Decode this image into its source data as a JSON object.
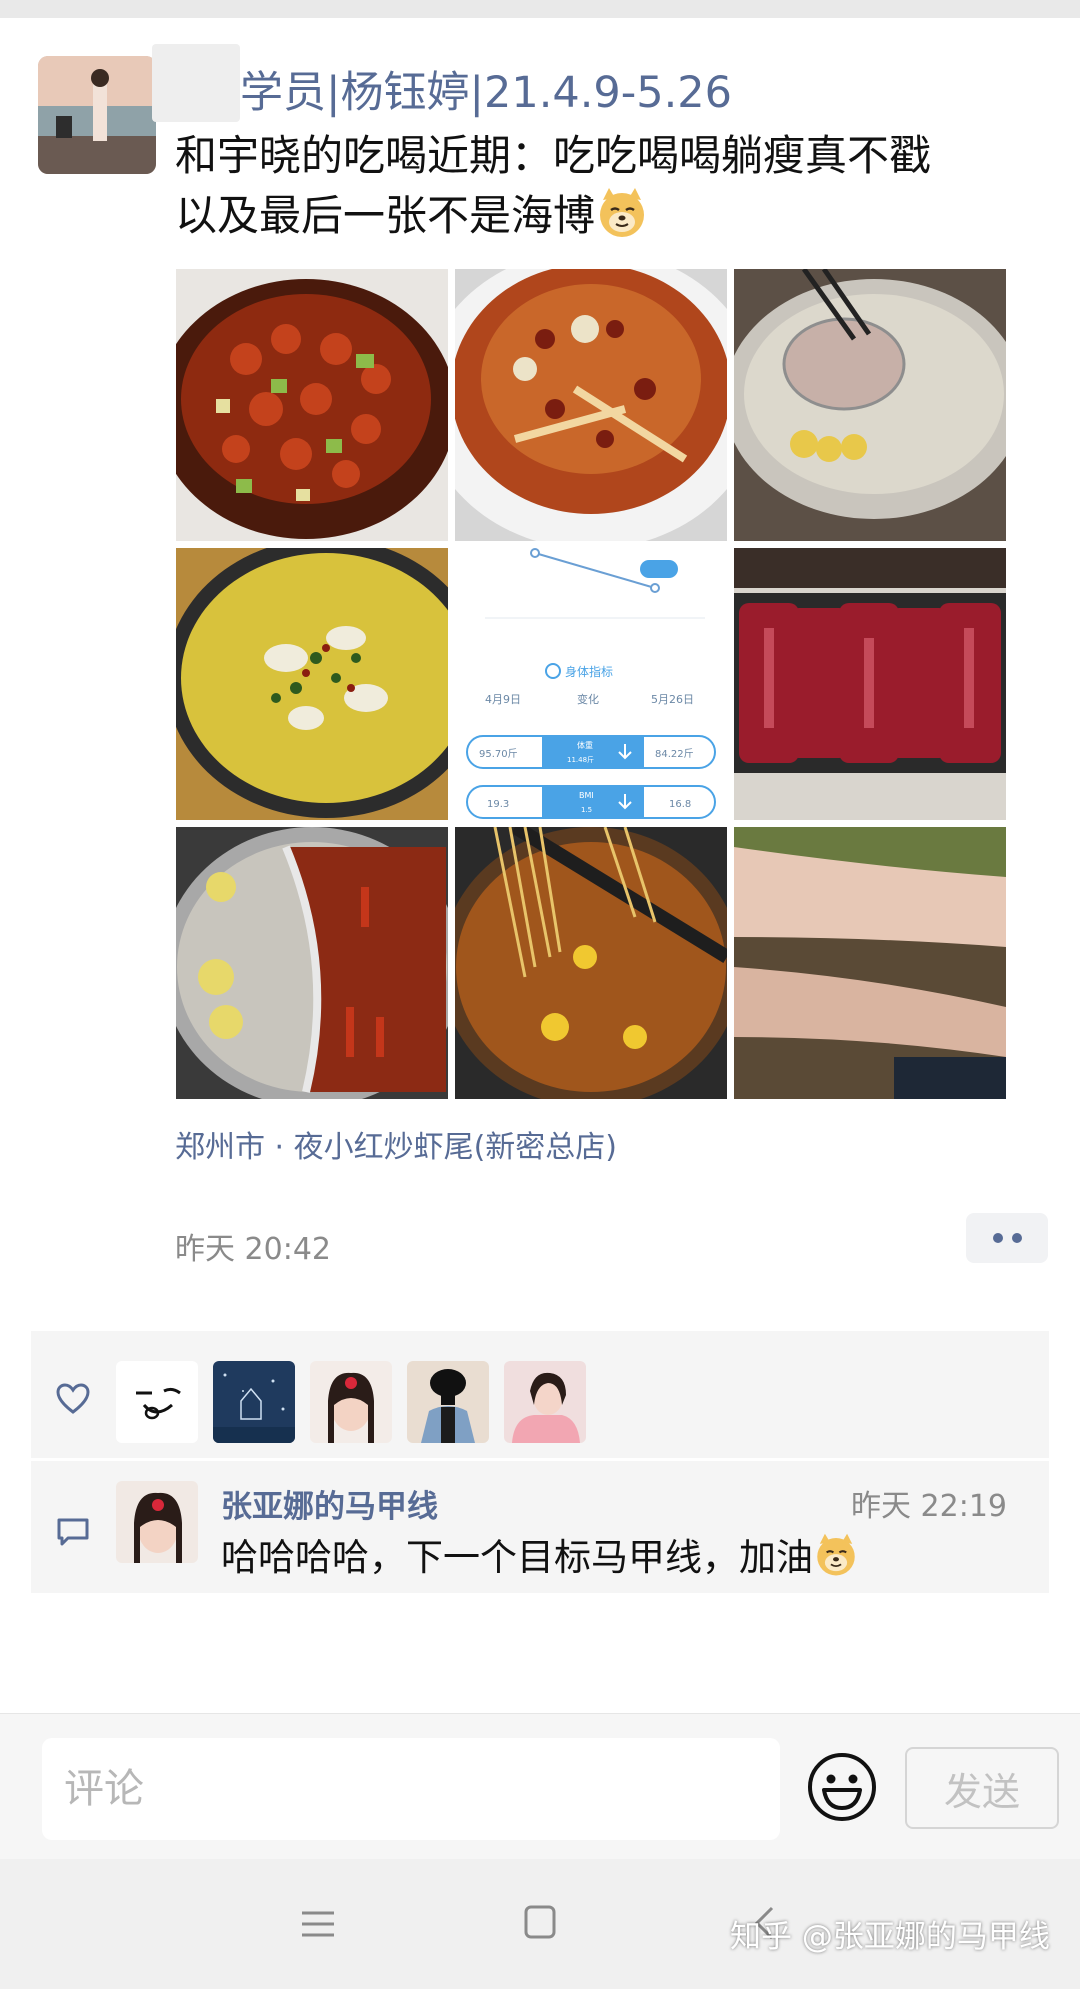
{
  "post": {
    "username": "学员|杨钰婷|21.4.9-5.26",
    "text_line1": "和宇晓的吃喝近期：吃吃喝喝躺瘦真不戳",
    "text_line2": "以及最后一张不是海博",
    "location": "郑州市 · 夜小红炒虾尾(新密总店)",
    "timestamp": "昨天 20:42",
    "images": [
      "crawfish-dish-photo",
      "spicy-fish-dish-photo",
      "clear-broth-hotpot-photo",
      "pickled-fish-dish-photo",
      "body-metrics-screenshot",
      "raw-beef-slices-photo",
      "yin-yang-hotpot-photo",
      "skewer-hotpot-photo",
      "arms-photo"
    ],
    "metrics": {
      "section_title": "身体指标",
      "col_start": "4月9日",
      "col_change": "变化",
      "col_end": "5月26日",
      "weight_start": "95.70斤",
      "weight_label": "体重",
      "weight_change": "11.48斤",
      "weight_end": "84.22斤",
      "bmi_start": "19.3",
      "bmi_label": "BMI",
      "bmi_change": "1.5",
      "bmi_end": "16.8"
    }
  },
  "likes": {
    "avatars": [
      "like-avatar-sticker",
      "like-avatar-night-sky",
      "like-avatar-girl-flower",
      "like-avatar-black-hat",
      "like-avatar-girl-pink"
    ]
  },
  "comment": {
    "author": "张亚娜的马甲线",
    "time": "昨天 22:19",
    "text": "哈哈哈哈，下一个目标马甲线，加油"
  },
  "input": {
    "placeholder": "评论",
    "send_label": "发送"
  },
  "watermark": "知乎 @张亚娜的马甲线",
  "colors": {
    "link": "#576b95",
    "meta": "#8a8a8a",
    "panel": "#f5f5f5"
  }
}
